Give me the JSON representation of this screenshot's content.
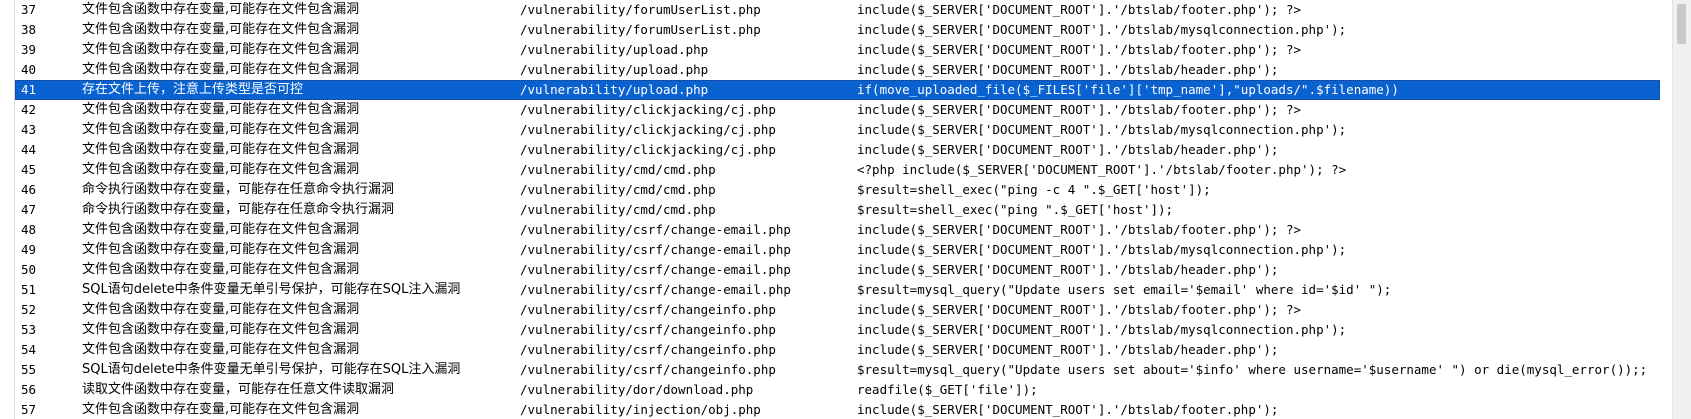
{
  "results": {
    "rows": [
      {
        "id": "37",
        "desc": "文件包含函数中存在变量,可能存在文件包含漏洞",
        "file": "/vulnerability/forumUserList.php",
        "code": "include($_SERVER['DOCUMENT_ROOT'].'/btslab/footer.php'); ?>"
      },
      {
        "id": "38",
        "desc": "文件包含函数中存在变量,可能存在文件包含漏洞",
        "file": "/vulnerability/forumUserList.php",
        "code": "include($_SERVER['DOCUMENT_ROOT'].'/btslab/mysqlconnection.php');"
      },
      {
        "id": "39",
        "desc": "文件包含函数中存在变量,可能存在文件包含漏洞",
        "file": "/vulnerability/upload.php",
        "code": "include($_SERVER['DOCUMENT_ROOT'].'/btslab/footer.php'); ?>"
      },
      {
        "id": "40",
        "desc": "文件包含函数中存在变量,可能存在文件包含漏洞",
        "file": "/vulnerability/upload.php",
        "code": "include($_SERVER['DOCUMENT_ROOT'].'/btslab/header.php');"
      },
      {
        "id": "41",
        "desc": "存在文件上传，注意上传类型是否可控",
        "file": "/vulnerability/upload.php",
        "code": "if(move_uploaded_file($_FILES['file']['tmp_name'],\"uploads/\".$filename))",
        "selected": true
      },
      {
        "id": "42",
        "desc": "文件包含函数中存在变量,可能存在文件包含漏洞",
        "file": "/vulnerability/clickjacking/cj.php",
        "code": "include($_SERVER['DOCUMENT_ROOT'].'/btslab/footer.php'); ?>"
      },
      {
        "id": "43",
        "desc": "文件包含函数中存在变量,可能存在文件包含漏洞",
        "file": "/vulnerability/clickjacking/cj.php",
        "code": "include($_SERVER['DOCUMENT_ROOT'].'/btslab/mysqlconnection.php');"
      },
      {
        "id": "44",
        "desc": "文件包含函数中存在变量,可能存在文件包含漏洞",
        "file": "/vulnerability/clickjacking/cj.php",
        "code": "include($_SERVER['DOCUMENT_ROOT'].'/btslab/header.php');"
      },
      {
        "id": "45",
        "desc": "文件包含函数中存在变量,可能存在文件包含漏洞",
        "file": "/vulnerability/cmd/cmd.php",
        "code": "<?php include($_SERVER['DOCUMENT_ROOT'].'/btslab/footer.php'); ?>"
      },
      {
        "id": "46",
        "desc": "命令执行函数中存在变量，可能存在任意命令执行漏洞",
        "file": "/vulnerability/cmd/cmd.php",
        "code": "$result=shell_exec(\"ping -c 4 \".$_GET['host']);"
      },
      {
        "id": "47",
        "desc": "命令执行函数中存在变量，可能存在任意命令执行漏洞",
        "file": "/vulnerability/cmd/cmd.php",
        "code": "$result=shell_exec(\"ping \".$_GET['host']);"
      },
      {
        "id": "48",
        "desc": "文件包含函数中存在变量,可能存在文件包含漏洞",
        "file": "/vulnerability/csrf/change-email.php",
        "code": "include($_SERVER['DOCUMENT_ROOT'].'/btslab/footer.php'); ?>"
      },
      {
        "id": "49",
        "desc": "文件包含函数中存在变量,可能存在文件包含漏洞",
        "file": "/vulnerability/csrf/change-email.php",
        "code": "include($_SERVER['DOCUMENT_ROOT'].'/btslab/mysqlconnection.php');"
      },
      {
        "id": "50",
        "desc": "文件包含函数中存在变量,可能存在文件包含漏洞",
        "file": "/vulnerability/csrf/change-email.php",
        "code": "include($_SERVER['DOCUMENT_ROOT'].'/btslab/header.php');"
      },
      {
        "id": "51",
        "desc": "SQL语句delete中条件变量无单引号保护，可能存在SQL注入漏洞",
        "file": "/vulnerability/csrf/change-email.php",
        "code": "$result=mysql_query(\"Update users set email='$email' where id='$id' \");"
      },
      {
        "id": "52",
        "desc": "文件包含函数中存在变量,可能存在文件包含漏洞",
        "file": "/vulnerability/csrf/changeinfo.php",
        "code": "include($_SERVER['DOCUMENT_ROOT'].'/btslab/footer.php'); ?>"
      },
      {
        "id": "53",
        "desc": "文件包含函数中存在变量,可能存在文件包含漏洞",
        "file": "/vulnerability/csrf/changeinfo.php",
        "code": "include($_SERVER['DOCUMENT_ROOT'].'/btslab/mysqlconnection.php');"
      },
      {
        "id": "54",
        "desc": "文件包含函数中存在变量,可能存在文件包含漏洞",
        "file": "/vulnerability/csrf/changeinfo.php",
        "code": "include($_SERVER['DOCUMENT_ROOT'].'/btslab/header.php');"
      },
      {
        "id": "55",
        "desc": "SQL语句delete中条件变量无单引号保护，可能存在SQL注入漏洞",
        "file": "/vulnerability/csrf/changeinfo.php",
        "code": "$result=mysql_query(\"Update users set about='$info' where username='$username' \") or die(mysql_error());;"
      },
      {
        "id": "56",
        "desc": "读取文件函数中存在变量，可能存在任意文件读取漏洞",
        "file": "/vulnerability/dor/download.php",
        "code": "readfile($_GET['file']);"
      },
      {
        "id": "57",
        "desc": "文件包含函数中存在变量,可能存在文件包含漏洞",
        "file": "/vulnerability/injection/obj.php",
        "code": "include($_SERVER['DOCUMENT_ROOT'].'/btslab/footer.php');"
      }
    ]
  },
  "colors": {
    "selection": "#0a62d0",
    "selection_text": "#ffffff"
  }
}
